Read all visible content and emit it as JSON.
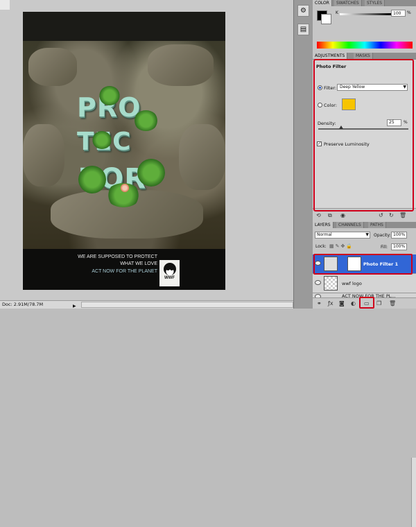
{
  "document": {
    "poster": {
      "headline_rows": [
        "PRO",
        "TEC",
        "TOR"
      ],
      "slogan_line1": "WE ARE SUPPOSED TO PROTECT",
      "slogan_line2": "WHAT WE LOVE",
      "slogan_line3": "ACT NOW FOR THE PLANET",
      "logo_text": "WWF"
    }
  },
  "status_bar": {
    "doc_info": "Doc: 2.91M/78.7M"
  },
  "color_panel": {
    "tabs": [
      "COLOR",
      "SWATCHES",
      "STYLES"
    ],
    "channel_label": "K",
    "channel_value": "100",
    "percent": "%",
    "foreground_color": "#000000",
    "background_color": "#ffffff"
  },
  "adjustments_panel": {
    "tabs": [
      "ADJUSTMENTS",
      "MASKS"
    ],
    "title": "Photo Filter",
    "filter_label": "Filter:",
    "filter_value": "Deep Yellow",
    "color_label": "Color:",
    "color_swatch": "#f7c400",
    "density_label": "Density:",
    "density_value": "25",
    "density_percent": "%",
    "density_level": 25,
    "preserve_luminosity_label": "Preserve Luminosity",
    "preserve_luminosity_checked": true
  },
  "layers_panel": {
    "tabs": [
      "LAYERS",
      "CHANNELS",
      "PATHS"
    ],
    "blend_mode": "Normal",
    "opacity_label": "Opacity:",
    "opacity_value": "100%",
    "lock_label": "Lock:",
    "fill_label": "Fill:",
    "fill_value": "100%",
    "layers": [
      {
        "name": "Photo Filter 1",
        "selected": true
      },
      {
        "name": "wwf logo",
        "selected": false
      },
      {
        "name": "ACT NOW FOR THE PL...",
        "selected": false
      }
    ]
  },
  "highlight_color": "#d0001a"
}
